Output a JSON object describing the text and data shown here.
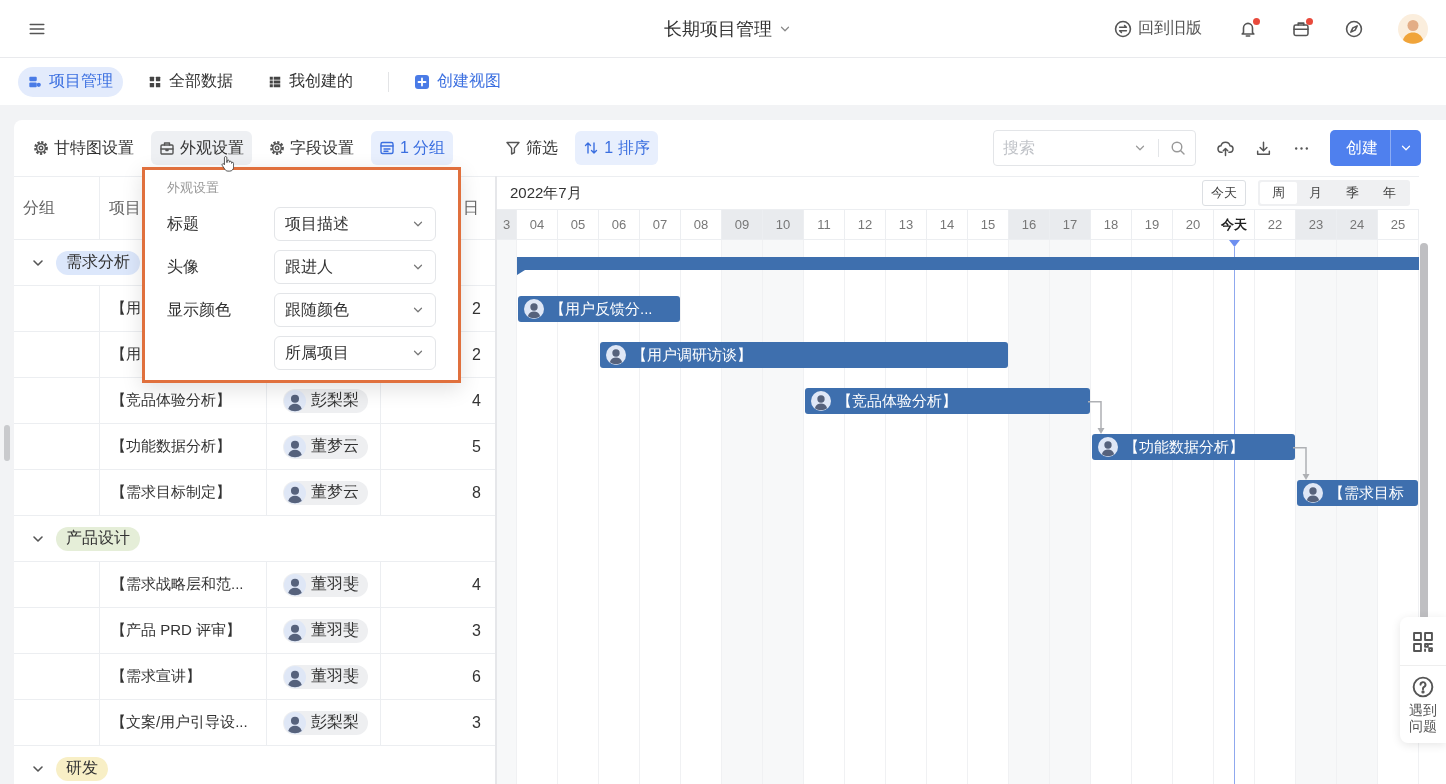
{
  "header": {
    "title": "长期项目管理",
    "legacy_link": "回到旧版",
    "actions": [
      {
        "kind": "bell",
        "badge": true
      },
      {
        "kind": "briefcase",
        "badge": true
      },
      {
        "kind": "compass",
        "badge": false
      }
    ]
  },
  "views": {
    "tabs": [
      {
        "label": "项目管理",
        "kind": "project",
        "selected": true
      },
      {
        "label": "全部数据",
        "kind": "grid",
        "selected": false
      },
      {
        "label": "我创建的",
        "kind": "list",
        "selected": false
      }
    ],
    "create_label": "创建视图"
  },
  "toolbar": {
    "buttons": [
      {
        "label": "甘特图设置",
        "kind": "gantt_settings",
        "hovered": false,
        "active": false
      },
      {
        "label": "外观设置",
        "kind": "appearance",
        "hovered": true,
        "active": false
      },
      {
        "label": "字段设置",
        "kind": "fields",
        "hovered": false,
        "active": false
      },
      {
        "label": "1 分组",
        "kind": "group",
        "hovered": false,
        "active": true
      },
      {
        "label": "筛选",
        "kind": "filter",
        "hovered": false,
        "active": false
      },
      {
        "label": "1 排序",
        "kind": "sort",
        "hovered": false,
        "active": true
      }
    ],
    "search": {
      "placeholder": "搜索"
    },
    "create_label": "创建"
  },
  "appearance_popup": {
    "title": "外观设置",
    "fields": [
      {
        "label": "标题",
        "value": "项目描述"
      },
      {
        "label": "头像",
        "value": "跟进人"
      },
      {
        "label": "显示颜色",
        "value": "跟随颜色"
      },
      {
        "value": "所属项目"
      }
    ]
  },
  "table": {
    "headers": {
      "column_1": "分组",
      "column_2": "项目",
      "column_4": "日"
    }
  },
  "groups": [
    {
      "name": "需求分析",
      "color": "#dce7fb",
      "expanded": true,
      "summary_bar": true,
      "tasks": [
        {
          "title": "【用",
          "duration": "2",
          "depends_on_previous": false,
          "bar": {
            "label": "【用户反馈分..."
          }
        },
        {
          "title": "【用",
          "duration": "2",
          "depends_on_previous": false,
          "bar": {
            "label": "【用户调研访谈】"
          }
        },
        {
          "title": "【竞品体验分析】",
          "assignee": "彭梨梨",
          "duration": "4",
          "depends_on_previous": false,
          "bar": {
            "label": "【竞品体验分析】"
          }
        },
        {
          "title": "【功能数据分析】",
          "assignee": "董梦云",
          "duration": "5",
          "depends_on_previous": true,
          "bar": {
            "label": "【功能数据分析】"
          }
        },
        {
          "title": "【需求目标制定】",
          "assignee": "董梦云",
          "duration": "8",
          "depends_on_previous": true,
          "bar": {
            "label": "【需求目标"
          }
        }
      ]
    },
    {
      "name": "产品设计",
      "color": "#e5eed8",
      "expanded": true,
      "summary_bar": false,
      "tasks": [
        {
          "title": "【需求战略层和范...",
          "assignee": "董羽斐",
          "duration": "4",
          "depends_on_previous": false
        },
        {
          "title": "【产品 PRD 评审】",
          "assignee": "董羽斐",
          "duration": "3",
          "depends_on_previous": false
        },
        {
          "title": "【需求宣讲】",
          "assignee": "董羽斐",
          "duration": "6",
          "depends_on_previous": false
        },
        {
          "title": "【文案/用户引导设...",
          "assignee": "彭梨梨",
          "duration": "3",
          "depends_on_previous": false
        }
      ]
    },
    {
      "name": "研发",
      "color": "#f8efc6",
      "expanded": true,
      "summary_bar": false
    }
  ],
  "gantt": {
    "month": "2022年7月",
    "today_button": "今天",
    "scales": [
      {
        "label": "周",
        "selected": true
      },
      {
        "label": "月",
        "selected": false
      },
      {
        "label": "季",
        "selected": false
      },
      {
        "label": "年",
        "selected": false
      }
    ],
    "days": [
      {
        "label": "3",
        "weekend": true,
        "today": false
      },
      {
        "label": "04",
        "weekend": false,
        "today": false
      },
      {
        "label": "05",
        "weekend": false,
        "today": false
      },
      {
        "label": "06",
        "weekend": false,
        "today": false
      },
      {
        "label": "07",
        "weekend": false,
        "today": false
      },
      {
        "label": "08",
        "weekend": false,
        "today": false
      },
      {
        "label": "09",
        "weekend": true,
        "today": false
      },
      {
        "label": "10",
        "weekend": true,
        "today": false
      },
      {
        "label": "11",
        "weekend": false,
        "today": false
      },
      {
        "label": "12",
        "weekend": false,
        "today": false
      },
      {
        "label": "13",
        "weekend": false,
        "today": false
      },
      {
        "label": "14",
        "weekend": false,
        "today": false
      },
      {
        "label": "15",
        "weekend": false,
        "today": false
      },
      {
        "label": "16",
        "weekend": true,
        "today": false
      },
      {
        "label": "17",
        "weekend": true,
        "today": false
      },
      {
        "label": "18",
        "weekend": false,
        "today": false
      },
      {
        "label": "19",
        "weekend": false,
        "today": false
      },
      {
        "label": "20",
        "weekend": false,
        "today": false
      },
      {
        "label": "今天",
        "weekend": false,
        "today": true
      },
      {
        "label": "22",
        "weekend": false,
        "today": false
      },
      {
        "label": "23",
        "weekend": true,
        "today": false
      },
      {
        "label": "24",
        "weekend": true,
        "today": false
      },
      {
        "label": "25",
        "weekend": false,
        "today": false
      }
    ]
  },
  "side_panel": {
    "help_label": "遇到问题"
  }
}
